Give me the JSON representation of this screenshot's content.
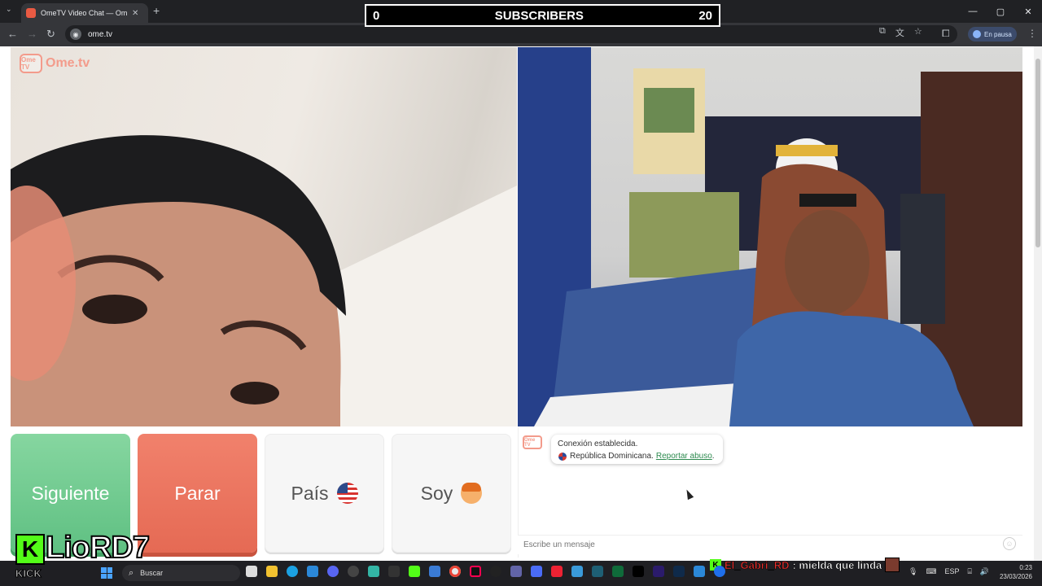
{
  "browser": {
    "tab_title": "OmeTV Video Chat — Ome",
    "tab_close": "✕",
    "new_tab": "+",
    "url": "ome.tv",
    "profile_status": "En pausa",
    "controls": {
      "minimize": "—",
      "maximize": "▢",
      "close": "✕"
    }
  },
  "overlay": {
    "subs_left": "0",
    "subs_label": "SUBSCRIBERS",
    "subs_right": "20",
    "streamer_name": "LioRD7",
    "streamer_logo": "K",
    "streamer_platform": "KICK",
    "chat_user": "El_Gabri_RD",
    "chat_message": ": mielda que linda"
  },
  "page": {
    "logo_badge": "Ome TV",
    "logo_text": "Ome.tv",
    "buttons": {
      "next": "Siguiente",
      "stop": "Parar",
      "country": "País",
      "gender": "Soy"
    },
    "chat": {
      "logo_badge": "Ome TV",
      "system_line1": "Conexión establecida.",
      "system_country": "República Dominicana.",
      "report_link": "Reportar abuso",
      "report_suffix": ".",
      "input_placeholder": "Escribe un mensaje"
    }
  },
  "taskbar": {
    "search_label": "Buscar",
    "lang": "ESP",
    "time": "0:23",
    "date": "23/03/2026"
  },
  "icons": {
    "country_flag": "us-flag-icon",
    "gender": "boy-icon",
    "chat_country_flag": "dominican-flag-icon"
  },
  "colors": {
    "next": "#5fc082",
    "stop": "#e56a54",
    "ome_accent": "#f39b8b",
    "kick": "#53fc18",
    "chat_user": "#e8302e"
  }
}
